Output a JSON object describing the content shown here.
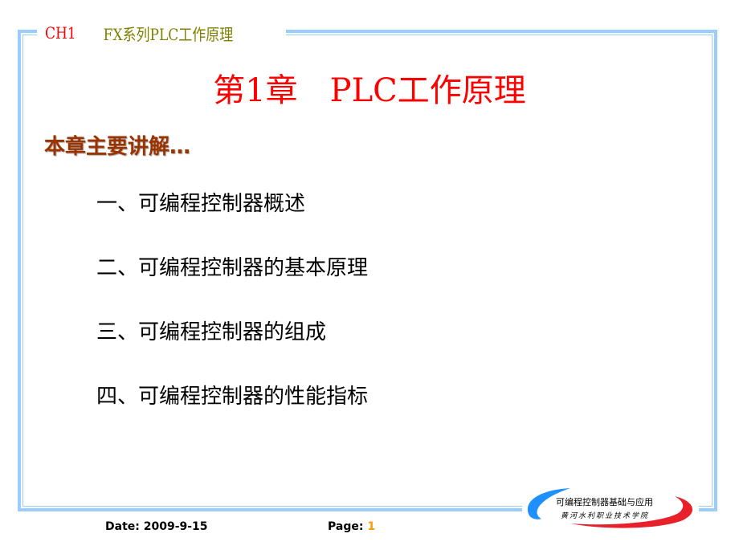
{
  "header": {
    "chapter_code": "CH1",
    "course_title": "FX系列PLC工作原理"
  },
  "title": {
    "part1": "第1章",
    "part2": "PLC工作原理"
  },
  "subtitle": "本章主要讲解…",
  "items": [
    "一、可编程控制器概述",
    "二、可编程控制器的基本原理",
    "三、可编程控制器的组成",
    "四、可编程控制器的性能指标"
  ],
  "footer": {
    "date_label": "Date:",
    "date_value": "2009-9-15",
    "page_label": "Page:",
    "page_value": "1"
  },
  "logo": {
    "line1": "可编程控制器基础与应用",
    "line2": "黄河水利职业技术学院"
  },
  "colors": {
    "frame": "#99ccff",
    "title": "#ff0000",
    "subtitle": "#993300",
    "course": "#808000",
    "page_number": "#ff9900"
  }
}
